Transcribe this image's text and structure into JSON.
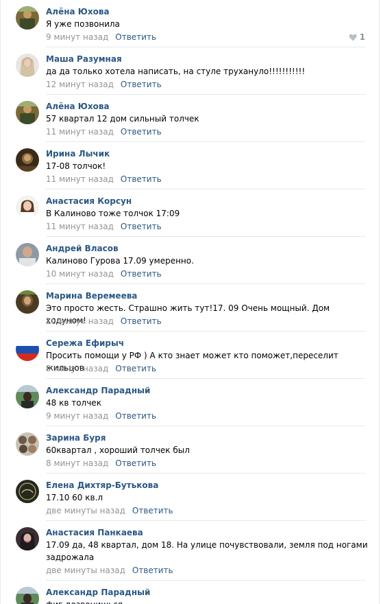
{
  "reply_label": "Ответить",
  "like_count": "1",
  "colors": {
    "author": "#2a5885",
    "link": "#2a5885",
    "meta": "#939393",
    "divider": "#e7e8ec"
  },
  "comments": [
    {
      "author": "Алёна Юхова",
      "text": "Я уже позвонила",
      "time": "9 минут назад"
    },
    {
      "author": "Маша Разумная",
      "text": "да да только хотела написать, на стуле труxануло!!!!!!!!!!!",
      "time": "12 минут назад"
    },
    {
      "author": "Алёна Юхова",
      "text": "57 квартал 12 дом сильный толчек",
      "time": "11 минут назад"
    },
    {
      "author": "Ирина Лычик",
      "text": "17-08 толчок!",
      "time": "11 минут назад"
    },
    {
      "author": "Анастасия Корсун",
      "text": "В Калиново тоже толчок 17:09",
      "time": "11 минут назад"
    },
    {
      "author": "Андрей Власов",
      "text": "Калиново Гурова 17.09 умеренно.",
      "time": "10 минут назад"
    },
    {
      "author": "Марина Веремеева",
      "text": "Это просто жесть. Страшно жить тут!17. 09 Очень мощный. Дом ходуном!",
      "time": "10 минут назад"
    },
    {
      "author": "Сережа Ефирыч",
      "text": "Просить помощи у РФ ) А кто знает может кто поможет,переселит жильцов",
      "time": "9 минут назад"
    },
    {
      "author": "Александр Парадный",
      "text": "48 кв толчек",
      "time": "9 минут назад"
    },
    {
      "author": "Зарина Буря",
      "text": "60квартал , хороший толчек был",
      "time": "8 минут назад"
    },
    {
      "author": "Елена Дихтяр-Бутькова",
      "text": "17.10 60 кв.л",
      "time": "две минуты назад"
    },
    {
      "author": "Анастасия Панкаева",
      "text": "17.09 да, 48 квартал, дом 18. На улице почувствовали, земля под ногами задрожала",
      "time": "две минуты назад"
    },
    {
      "author": "Александр Парадный",
      "text": "фиг дозвонишься",
      "time": ""
    }
  ]
}
